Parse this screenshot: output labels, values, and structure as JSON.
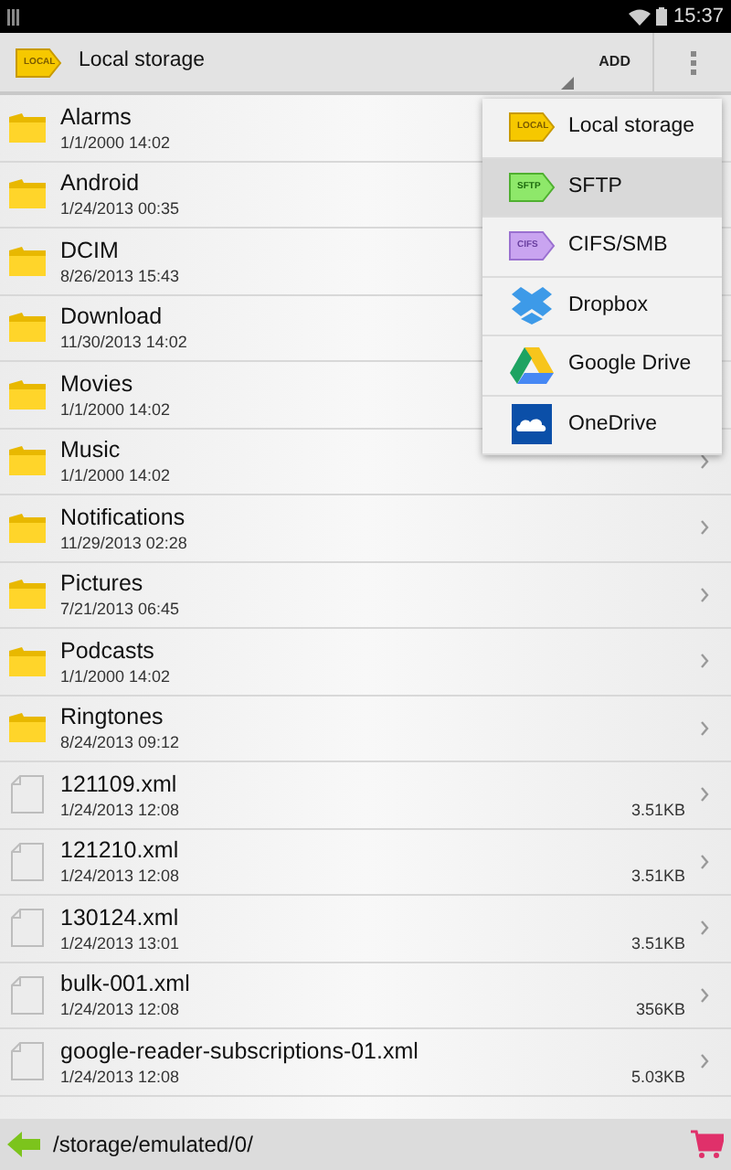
{
  "status_bar": {
    "time": "15:37"
  },
  "action_bar": {
    "location": {
      "tag": "LOCAL",
      "label": "Local storage"
    },
    "add_button": "ADD"
  },
  "files": [
    {
      "kind": "folder",
      "name": "Alarms",
      "date": "1/1/2000 14:02"
    },
    {
      "kind": "folder",
      "name": "Android",
      "date": "1/24/2013 00:35"
    },
    {
      "kind": "folder",
      "name": "DCIM",
      "date": "8/26/2013 15:43"
    },
    {
      "kind": "folder",
      "name": "Download",
      "date": "11/30/2013 14:02"
    },
    {
      "kind": "folder",
      "name": "Movies",
      "date": "1/1/2000 14:02"
    },
    {
      "kind": "folder",
      "name": "Music",
      "date": "1/1/2000 14:02"
    },
    {
      "kind": "folder",
      "name": "Notifications",
      "date": "11/29/2013 02:28"
    },
    {
      "kind": "folder",
      "name": "Pictures",
      "date": "7/21/2013 06:45"
    },
    {
      "kind": "folder",
      "name": "Podcasts",
      "date": "1/1/2000 14:02"
    },
    {
      "kind": "folder",
      "name": "Ringtones",
      "date": "8/24/2013 09:12"
    },
    {
      "kind": "file",
      "name": "121109.xml",
      "date": "1/24/2013 12:08",
      "size": "3.51KB"
    },
    {
      "kind": "file",
      "name": "121210.xml",
      "date": "1/24/2013 12:08",
      "size": "3.51KB"
    },
    {
      "kind": "file",
      "name": "130124.xml",
      "date": "1/24/2013 13:01",
      "size": "3.51KB"
    },
    {
      "kind": "file",
      "name": "bulk-001.xml",
      "date": "1/24/2013 12:08",
      "size": "356KB"
    },
    {
      "kind": "file",
      "name": "google-reader-subscriptions-01.xml",
      "date": "1/24/2013 12:08",
      "size": "5.03KB"
    }
  ],
  "storage_menu": [
    {
      "kind": "local",
      "tag": "LOCAL",
      "label": "Local storage",
      "selected": false
    },
    {
      "kind": "sftp",
      "tag": "SFTP",
      "label": "SFTP",
      "selected": true
    },
    {
      "kind": "cifs",
      "tag": "CIFS",
      "label": "CIFS/SMB",
      "selected": false
    },
    {
      "kind": "dropbox",
      "label": "Dropbox",
      "selected": false
    },
    {
      "kind": "gdrive",
      "label": "Google Drive",
      "selected": false
    },
    {
      "kind": "onedrive",
      "label": "OneDrive",
      "selected": false
    }
  ],
  "path_bar": {
    "path": "/storage/emulated/0/"
  }
}
